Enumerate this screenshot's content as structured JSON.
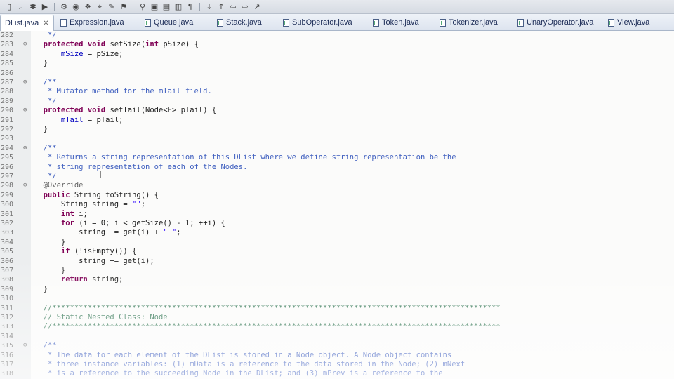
{
  "tabs": [
    {
      "label": "DList.java",
      "active": true
    },
    {
      "label": "Expression.java"
    },
    {
      "label": "Queue.java"
    },
    {
      "label": "Stack.java"
    },
    {
      "label": "SubOperator.java"
    },
    {
      "label": "Token.java"
    },
    {
      "label": "Tokenizer.java"
    },
    {
      "label": "UnaryOperator.java"
    },
    {
      "label": "View.java"
    }
  ],
  "toolbar_icons": [
    "page-icon",
    "search-icon",
    "debug-icon",
    "run-icon",
    "external-tool-icon",
    "new-class-icon",
    "open-type-icon",
    "search-file-icon",
    "pen-icon",
    "pin-icon",
    "annotation-icon",
    "task-icon",
    "highlight-icon",
    "block-icon",
    "pilcrow-icon",
    "next-annotation-icon",
    "prev-annotation-icon",
    "back-icon",
    "forward-icon",
    "external-icon"
  ],
  "lines": [
    {
      "n": "282",
      "fold": "",
      "t": "      */"
    },
    {
      "n": "283",
      "fold": "⊖",
      "t": "     protected void setSize(int pSize) {"
    },
    {
      "n": "284",
      "fold": "",
      "t": "         mSize = pSize;"
    },
    {
      "n": "285",
      "fold": "",
      "t": "     }"
    },
    {
      "n": "286",
      "fold": "",
      "t": ""
    },
    {
      "n": "287",
      "fold": "⊖",
      "t": "     /**"
    },
    {
      "n": "288",
      "fold": "",
      "t": "      * Mutator method for the mTail field."
    },
    {
      "n": "289",
      "fold": "",
      "t": "      */"
    },
    {
      "n": "290",
      "fold": "⊖",
      "t": "     protected void setTail(Node<E> pTail) {"
    },
    {
      "n": "291",
      "fold": "",
      "t": "         mTail = pTail;"
    },
    {
      "n": "292",
      "fold": "",
      "t": "     }"
    },
    {
      "n": "293",
      "fold": "",
      "t": ""
    },
    {
      "n": "294",
      "fold": "⊖",
      "t": "     /**"
    },
    {
      "n": "295",
      "fold": "",
      "t": "      * Returns a string representation of this DList where we define string representation be the"
    },
    {
      "n": "296",
      "fold": "",
      "t": "      * string representation of each of the Nodes."
    },
    {
      "n": "297",
      "fold": "",
      "t": "      */"
    },
    {
      "n": "298",
      "fold": "⊖",
      "t": "     @Override"
    },
    {
      "n": "299",
      "fold": "",
      "t": "     public String toString() {"
    },
    {
      "n": "300",
      "fold": "",
      "t": "         String string = \"\";"
    },
    {
      "n": "301",
      "fold": "",
      "t": "         int i;"
    },
    {
      "n": "302",
      "fold": "",
      "t": "         for (i = 0; i < getSize() - 1; ++i) {"
    },
    {
      "n": "303",
      "fold": "",
      "t": "             string += get(i) + \" \";"
    },
    {
      "n": "304",
      "fold": "",
      "t": "         }"
    },
    {
      "n": "305",
      "fold": "",
      "t": "         if (!isEmpty()) {"
    },
    {
      "n": "306",
      "fold": "",
      "t": "             string += get(i);"
    },
    {
      "n": "307",
      "fold": "",
      "t": "         }"
    },
    {
      "n": "308",
      "fold": "",
      "t": "         return string;"
    },
    {
      "n": "309",
      "fold": "",
      "t": "     }"
    },
    {
      "n": "310",
      "fold": "",
      "t": ""
    },
    {
      "n": "311",
      "fold": "",
      "t": "     //*****************************************************************************************************"
    },
    {
      "n": "312",
      "fold": "",
      "t": "     // Static Nested Class: Node"
    },
    {
      "n": "313",
      "fold": "",
      "t": "     //*****************************************************************************************************"
    },
    {
      "n": "314",
      "fold": "",
      "t": ""
    },
    {
      "n": "315",
      "fold": "⊖",
      "t": "     /**"
    },
    {
      "n": "316",
      "fold": "",
      "t": "      * The data for each element of the DList is stored in a Node object. A Node object contains"
    },
    {
      "n": "317",
      "fold": "",
      "t": "      * three instance variables: (1) mData is a reference to the data stored in the Node; (2) mNext"
    },
    {
      "n": "318",
      "fold": "",
      "t": "      * is a reference to the succeeding Node in the DList; and (3) mPrev is a reference to the"
    }
  ]
}
